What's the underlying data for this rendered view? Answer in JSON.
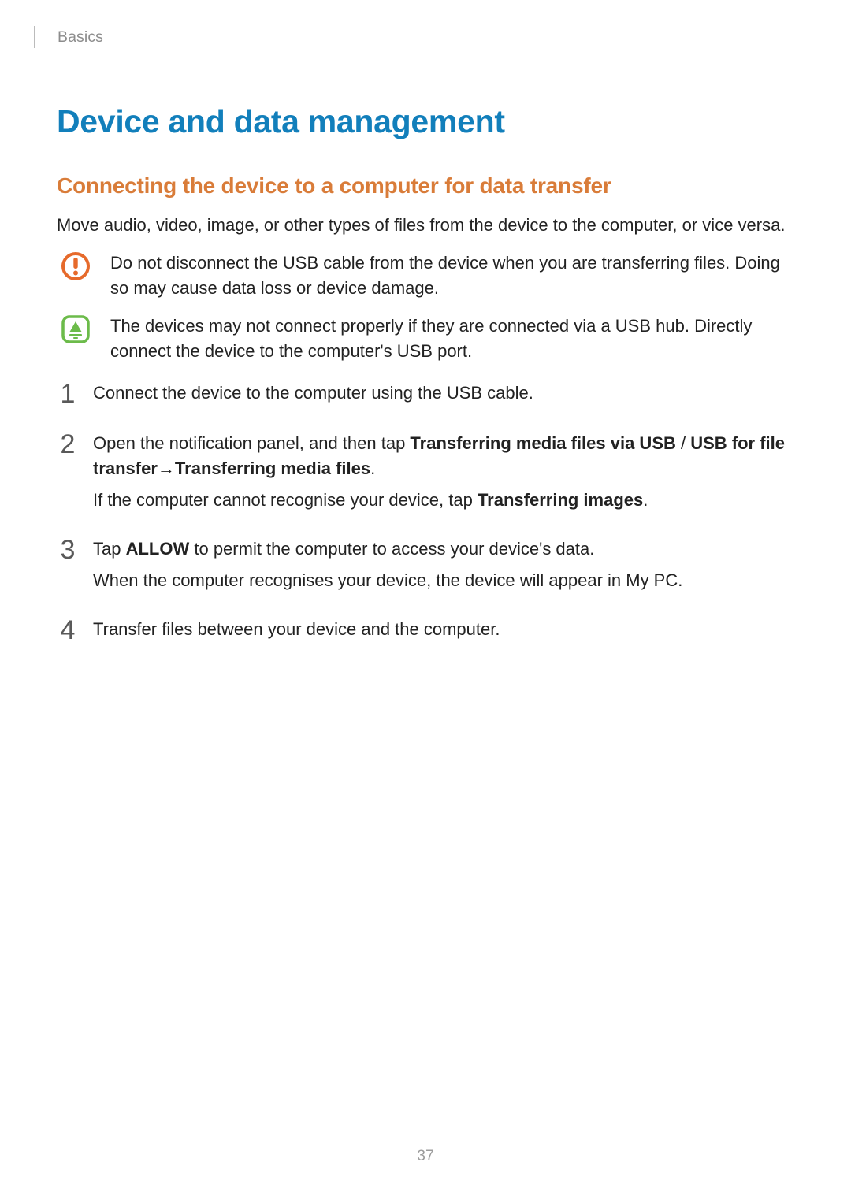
{
  "header": {
    "section": "Basics"
  },
  "title": "Device and data management",
  "subtitle": "Connecting the device to a computer for data transfer",
  "intro": "Move audio, video, image, or other types of files from the device to the computer, or vice versa.",
  "callouts": [
    {
      "icon": "warning-exclaim-icon",
      "text": "Do not disconnect the USB cable from the device when you are transferring files. Doing so may cause data loss or device damage."
    },
    {
      "icon": "note-bell-icon",
      "text": "The devices may not connect properly if they are connected via a USB hub. Directly connect the device to the computer's USB port."
    }
  ],
  "steps": [
    {
      "num": "1",
      "paragraphs": [
        {
          "runs": [
            {
              "t": "Connect the device to the computer using the USB cable."
            }
          ]
        }
      ]
    },
    {
      "num": "2",
      "paragraphs": [
        {
          "runs": [
            {
              "t": "Open the notification panel, and then tap "
            },
            {
              "t": "Transferring media files via USB",
              "b": true
            },
            {
              "t": " / "
            },
            {
              "t": "USB for file transfer",
              "b": true
            },
            {
              "t": " → ",
              "arrow": true
            },
            {
              "t": "Transferring media files",
              "b": true
            },
            {
              "t": "."
            }
          ]
        },
        {
          "runs": [
            {
              "t": "If the computer cannot recognise your device, tap "
            },
            {
              "t": "Transferring images",
              "b": true
            },
            {
              "t": "."
            }
          ]
        }
      ]
    },
    {
      "num": "3",
      "paragraphs": [
        {
          "runs": [
            {
              "t": "Tap "
            },
            {
              "t": "ALLOW",
              "b": true
            },
            {
              "t": " to permit the computer to access your device's data."
            }
          ]
        },
        {
          "runs": [
            {
              "t": "When the computer recognises your device, the device will appear in My PC."
            }
          ]
        }
      ]
    },
    {
      "num": "4",
      "paragraphs": [
        {
          "runs": [
            {
              "t": "Transfer files between your device and the computer."
            }
          ]
        }
      ]
    }
  ],
  "page_number": "37"
}
